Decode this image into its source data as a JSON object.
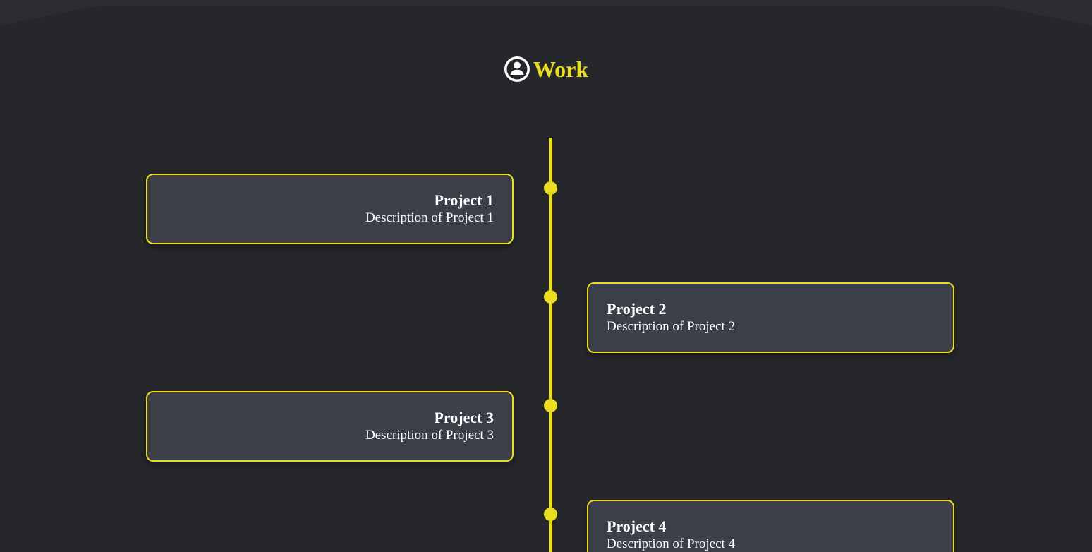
{
  "section": {
    "title": "Work",
    "icon": "user-circle-icon"
  },
  "colors": {
    "background": "#25272b",
    "accent": "#e9dc21",
    "card_background": "#3d3f48",
    "text": "#ffffff"
  },
  "timeline": {
    "items": [
      {
        "title": "Project 1",
        "description": "Description of Project 1",
        "side": "left"
      },
      {
        "title": "Project 2",
        "description": "Description of Project 2",
        "side": "right"
      },
      {
        "title": "Project 3",
        "description": "Description of Project 3",
        "side": "left"
      },
      {
        "title": "Project 4",
        "description": "Description of Project 4",
        "side": "right"
      }
    ]
  }
}
